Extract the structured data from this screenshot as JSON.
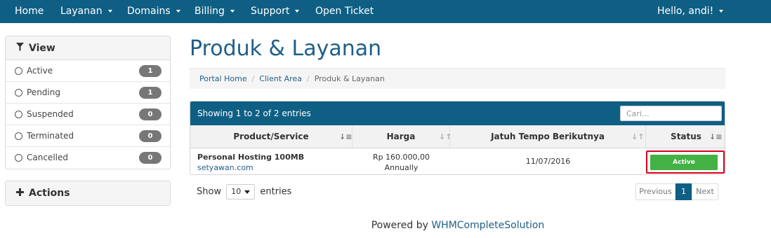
{
  "nav": {
    "home": "Home",
    "layanan": "Layanan",
    "domains": "Domains",
    "billing": "Billing",
    "support": "Support",
    "open_ticket": "Open Ticket",
    "user": "Hello, andi!"
  },
  "sidebar": {
    "view_title": "View",
    "items": [
      {
        "label": "Active",
        "count": "1"
      },
      {
        "label": "Pending",
        "count": "1"
      },
      {
        "label": "Suspended",
        "count": "0"
      },
      {
        "label": "Terminated",
        "count": "0"
      },
      {
        "label": "Cancelled",
        "count": "0"
      }
    ],
    "actions_title": "Actions"
  },
  "page": {
    "title": "Produk & Layanan"
  },
  "breadcrumb": {
    "items": [
      "Portal Home",
      "Client Area",
      "Produk & Layanan"
    ]
  },
  "table": {
    "showing": "Showing 1 to 2 of 2 entries",
    "search_placeholder": "Cari...",
    "headers": [
      "Product/Service",
      "Harga",
      "Jatuh Tempo Berikutnya",
      "Status"
    ],
    "rows": [
      {
        "product": "Personal Hosting 100MB",
        "domain": "setyawan.com",
        "price": "Rp 160.000,00",
        "cycle": "Annually",
        "due": "11/07/2016",
        "status": "Active"
      }
    ]
  },
  "controls": {
    "show_label": "Show",
    "page_size": "10",
    "entries_label": "entries",
    "previous": "Previous",
    "current_page": "1",
    "next": "Next"
  },
  "footer": {
    "powered_by": "Powered by",
    "link": "WHMCompleteSolution"
  },
  "colors": {
    "navbar": "#0f5f84",
    "link": "#1f5f86",
    "status_active": "#44b144",
    "highlight": "#d9001b"
  }
}
